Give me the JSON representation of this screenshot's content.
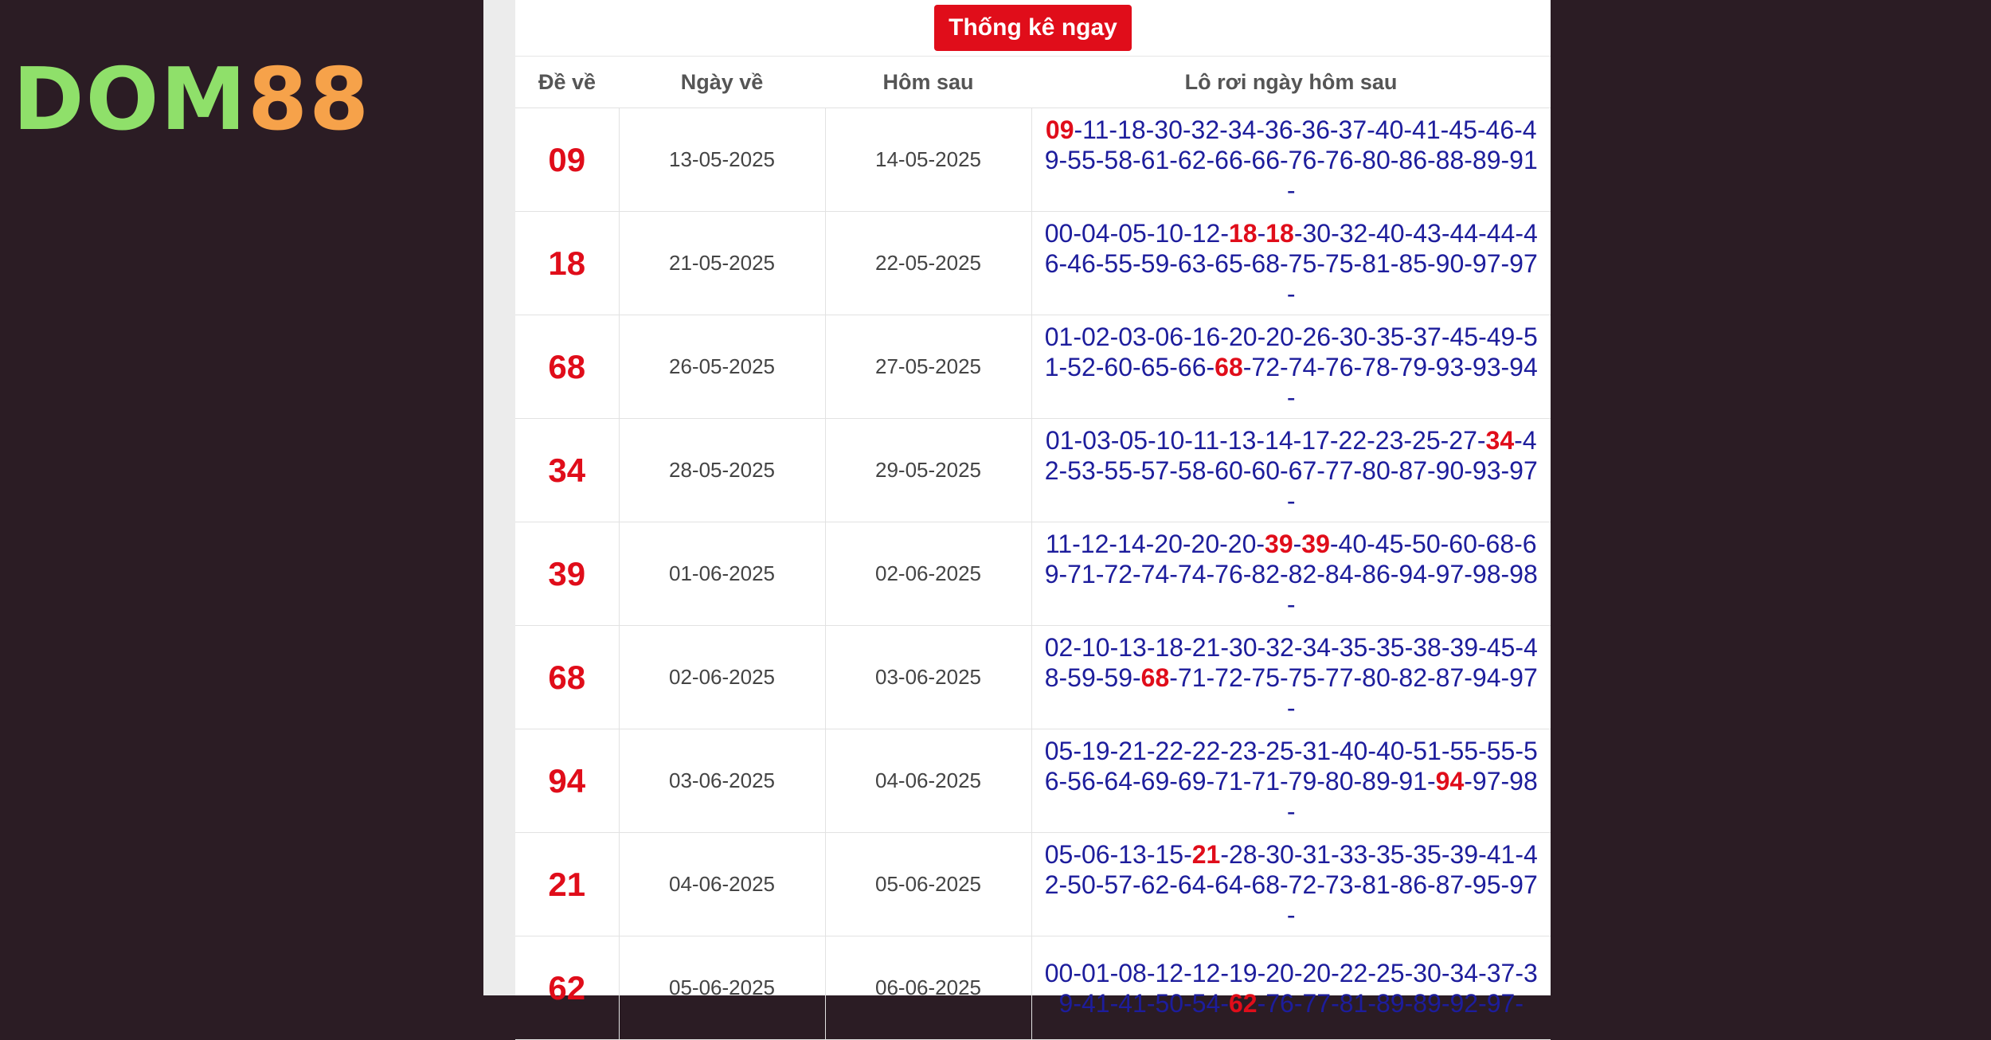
{
  "logo": {
    "part1": "DOM",
    "part2": "88"
  },
  "title_button": "Thống kê ngay",
  "headers": {
    "de_ve": "Đề về",
    "ngay_ve": "Ngày về",
    "hom_sau": "Hôm sau",
    "lo_roi": "Lô rơi ngày hôm sau"
  },
  "rows": [
    {
      "de": "09",
      "ngay_ve": "13-05-2025",
      "hom_sau": "14-05-2025",
      "lo": [
        "09",
        "11",
        "18",
        "30",
        "32",
        "34",
        "36",
        "36",
        "37",
        "40",
        "41",
        "45",
        "46",
        "49",
        "55",
        "58",
        "61",
        "62",
        "66",
        "66",
        "76",
        "76",
        "80",
        "86",
        "88",
        "89",
        "91"
      ]
    },
    {
      "de": "18",
      "ngay_ve": "21-05-2025",
      "hom_sau": "22-05-2025",
      "lo": [
        "00",
        "04",
        "05",
        "10",
        "12",
        "18",
        "18",
        "30",
        "32",
        "40",
        "43",
        "44",
        "44",
        "46",
        "46",
        "55",
        "59",
        "63",
        "65",
        "68",
        "75",
        "75",
        "81",
        "85",
        "90",
        "97",
        "97"
      ]
    },
    {
      "de": "68",
      "ngay_ve": "26-05-2025",
      "hom_sau": "27-05-2025",
      "lo": [
        "01",
        "02",
        "03",
        "06",
        "16",
        "20",
        "20",
        "26",
        "30",
        "35",
        "37",
        "45",
        "49",
        "51",
        "52",
        "60",
        "65",
        "66",
        "68",
        "72",
        "74",
        "76",
        "78",
        "79",
        "93",
        "93",
        "94"
      ]
    },
    {
      "de": "34",
      "ngay_ve": "28-05-2025",
      "hom_sau": "29-05-2025",
      "lo": [
        "01",
        "03",
        "05",
        "10",
        "11",
        "13",
        "14",
        "17",
        "22",
        "23",
        "25",
        "27",
        "34",
        "42",
        "53",
        "55",
        "57",
        "58",
        "60",
        "60",
        "67",
        "77",
        "80",
        "87",
        "90",
        "93",
        "97"
      ]
    },
    {
      "de": "39",
      "ngay_ve": "01-06-2025",
      "hom_sau": "02-06-2025",
      "lo": [
        "11",
        "12",
        "14",
        "20",
        "20",
        "20",
        "39",
        "39",
        "40",
        "45",
        "50",
        "60",
        "68",
        "69",
        "71",
        "72",
        "74",
        "74",
        "76",
        "82",
        "82",
        "84",
        "86",
        "94",
        "97",
        "98",
        "98"
      ]
    },
    {
      "de": "68",
      "ngay_ve": "02-06-2025",
      "hom_sau": "03-06-2025",
      "lo": [
        "02",
        "10",
        "13",
        "18",
        "21",
        "30",
        "32",
        "34",
        "35",
        "35",
        "38",
        "39",
        "45",
        "48",
        "59",
        "59",
        "68",
        "71",
        "72",
        "75",
        "75",
        "77",
        "80",
        "82",
        "87",
        "94",
        "97"
      ]
    },
    {
      "de": "94",
      "ngay_ve": "03-06-2025",
      "hom_sau": "04-06-2025",
      "lo": [
        "05",
        "19",
        "21",
        "22",
        "22",
        "23",
        "25",
        "31",
        "40",
        "40",
        "51",
        "55",
        "55",
        "56",
        "56",
        "64",
        "69",
        "69",
        "71",
        "71",
        "79",
        "80",
        "89",
        "91",
        "94",
        "97",
        "98"
      ]
    },
    {
      "de": "21",
      "ngay_ve": "04-06-2025",
      "hom_sau": "05-06-2025",
      "lo": [
        "05",
        "06",
        "13",
        "15",
        "21",
        "28",
        "30",
        "31",
        "33",
        "35",
        "35",
        "39",
        "41",
        "42",
        "50",
        "57",
        "62",
        "64",
        "64",
        "68",
        "72",
        "73",
        "81",
        "86",
        "87",
        "95",
        "97"
      ]
    },
    {
      "de": "62",
      "ngay_ve": "05-06-2025",
      "hom_sau": "06-06-2025",
      "lo": [
        "00",
        "01",
        "08",
        "12",
        "12",
        "19",
        "20",
        "20",
        "22",
        "25",
        "30",
        "34",
        "37",
        "39",
        "41",
        "41",
        "50",
        "54",
        "62",
        "76",
        "77",
        "81",
        "89",
        "89",
        "92",
        "97"
      ]
    }
  ],
  "colors": {
    "accent_red": "#e00d1a",
    "number_blue": "#1d1d9c",
    "background": "#2b1c24",
    "logo_green": "#8fe06a",
    "logo_orange": "#f6a24a"
  }
}
